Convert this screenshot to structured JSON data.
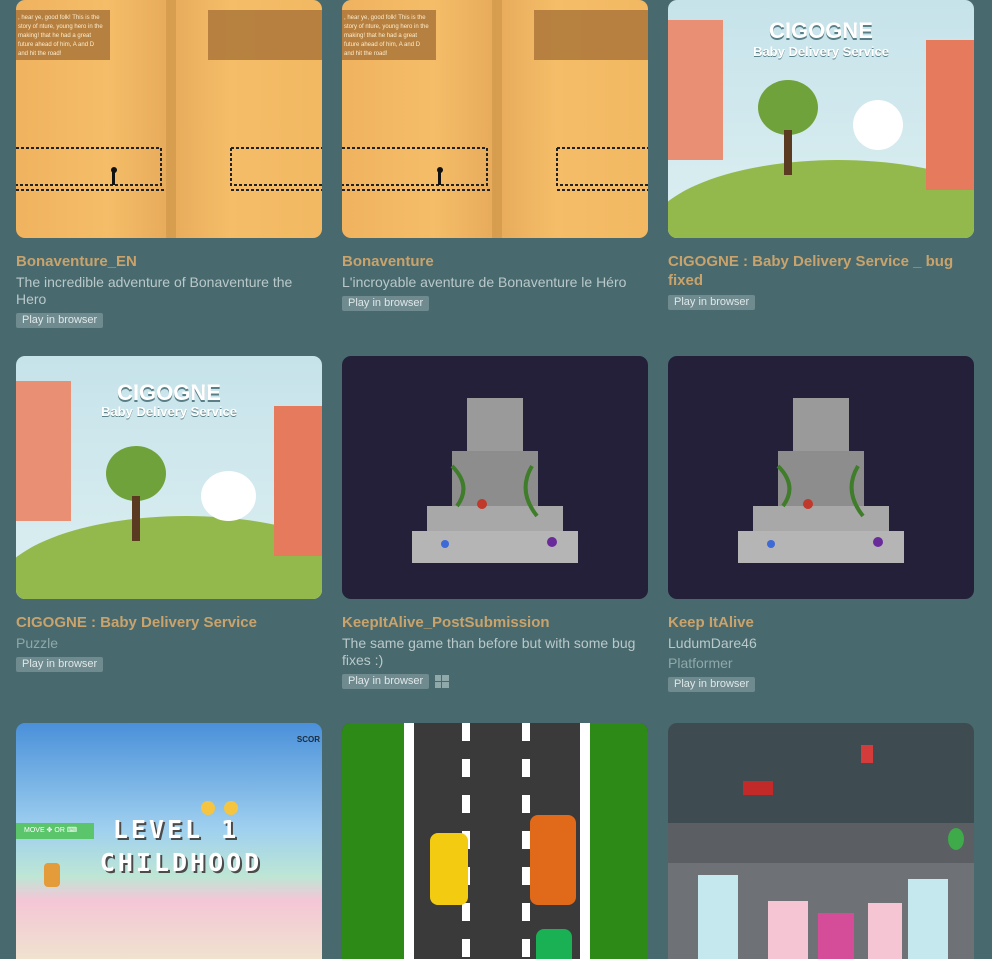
{
  "games": [
    {
      "title": "Bonaventure_EN",
      "description": "The incredible adventure of Bonaventure the Hero",
      "genre": "",
      "tag": "Play in browser",
      "story": ", hear ye, good folk! This is the story of nture, young hero in the making! that he had a great future ahead of him, A and D and hit the road!"
    },
    {
      "title": "Bonaventure",
      "description": "L'incroyable aventure de Bonaventure le Héro",
      "genre": "",
      "tag": "Play in browser",
      "story": ", hear ye, good folk! This is the story of nture, young hero in the making! that he had a great future ahead of him, A and D and hit the road!"
    },
    {
      "title": "CIGOGNE : Baby Delivery Service _ bug fixed",
      "description": "",
      "genre": "",
      "tag": "Play in browser",
      "logo_title": "CIGOGNE",
      "logo_sub": "Baby Delivery Service"
    },
    {
      "title": "CIGOGNE : Baby Delivery Service",
      "description": "",
      "genre": "Puzzle",
      "tag": "Play in browser",
      "logo_title": "CIGOGNE",
      "logo_sub": "Baby Delivery Service"
    },
    {
      "title": "KeepItAlive_PostSubmission",
      "description": "The same game than before but with some bug fixes :)",
      "genre": "",
      "tag": "Play in browser",
      "platform_icon": "windows-icon"
    },
    {
      "title": "Keep ItAlive",
      "description": "LudumDare46",
      "genre": "Platformer",
      "tag": "Play in browser"
    },
    {
      "title": "",
      "level_line1": "LEVEL 1",
      "level_line2": "CHILDHOOD",
      "hud": "MOVE ✥ OR ⌨",
      "score_label": "SCOR"
    },
    {
      "title": ""
    },
    {
      "title": ""
    }
  ],
  "colors": {
    "background": "#486a6f",
    "title": "#c9a36b",
    "tag_bg": "#6f8b8f"
  }
}
